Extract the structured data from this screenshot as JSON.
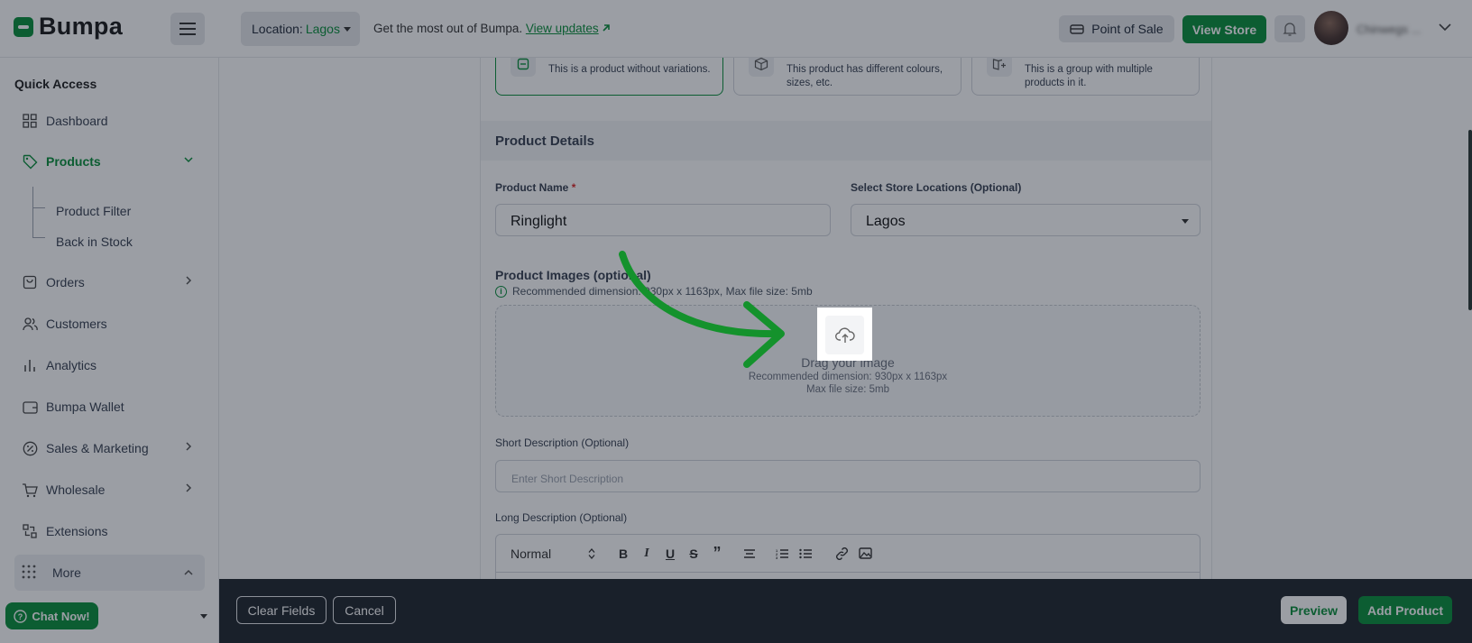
{
  "header": {
    "logo_text": "Bumpa",
    "location_label": "Location:",
    "location_value": "Lagos",
    "promo_text": "Get the most out of Bumpa.",
    "promo_link": "View updates",
    "pos_label": "Point of Sale",
    "view_store_label": "View Store",
    "user_name": "Chinwegs ..."
  },
  "sidebar": {
    "section_title": "Quick Access",
    "items": [
      {
        "label": "Dashboard",
        "icon": "grid-icon"
      },
      {
        "label": "Products",
        "icon": "tag-icon",
        "active": true
      },
      {
        "label": "Orders",
        "icon": "bag-icon"
      },
      {
        "label": "Customers",
        "icon": "users-icon"
      },
      {
        "label": "Analytics",
        "icon": "bar-chart-icon"
      },
      {
        "label": "Bumpa Wallet",
        "icon": "wallet-icon"
      },
      {
        "label": "Sales & Marketing",
        "icon": "percent-icon"
      },
      {
        "label": "Wholesale",
        "icon": "cart-icon"
      },
      {
        "label": "Extensions",
        "icon": "extensions-icon"
      }
    ],
    "sub_items": [
      "Product Filter",
      "Back in Stock"
    ],
    "more_label": "More",
    "chat_label": "Chat Now!"
  },
  "product_types": [
    {
      "desc": "This is a product without variations.",
      "selected": true
    },
    {
      "desc": "This product has different colours, sizes, etc.",
      "selected": false
    },
    {
      "desc": "This is a group with multiple products in it.",
      "selected": false
    }
  ],
  "form": {
    "section_title": "Product Details",
    "product_name_label": "Product Name",
    "required_mark": "*",
    "product_name_value": "Ringlight",
    "store_locations_label": "Select Store Locations (Optional)",
    "store_locations_value": "Lagos",
    "images_label": "Product Images (optional)",
    "images_hint": "Recommended dimension: 930px x 1163px, Max file size: 5mb",
    "dropzone_title": "Drag your image",
    "dropzone_dimension": "Recommended dimension: 930px x 1163px",
    "dropzone_size": "Max file size: 5mb",
    "short_desc_label": "Short Description (Optional)",
    "short_desc_placeholder": "Enter Short Description",
    "long_desc_label": "Long Description (Optional)",
    "editor_format": "Normal"
  },
  "footer": {
    "clear_label": "Clear Fields",
    "cancel_label": "Cancel",
    "preview_label": "Preview",
    "add_label": "Add Product"
  },
  "colors": {
    "brand_green": "#0a8f3c",
    "overlay": "rgba(17,24,39,0.42)",
    "footer_bg": "#20262e",
    "annotation_arrow": "#14922c"
  }
}
